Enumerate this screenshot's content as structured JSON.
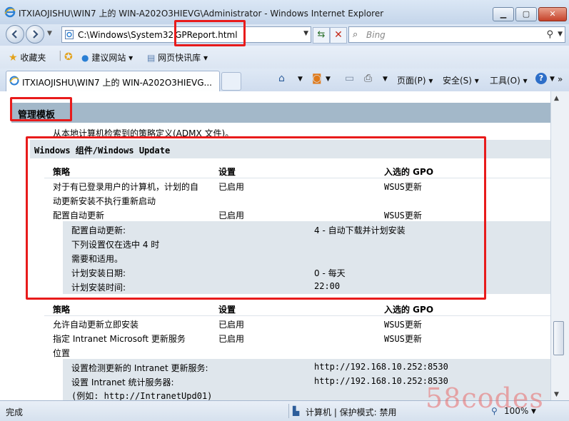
{
  "window": {
    "title": "ITXIAOJISHU\\WIN7 上的 WIN-A202O3HIEVG\\Administrator - Windows Internet Explorer"
  },
  "address_bar": {
    "url_prefix": "C:\\Windows\\System32",
    "url_file": "GPReport.html",
    "search_placeholder": "Bing"
  },
  "favorites_bar": {
    "favorites_label": "收藏夹",
    "suggested_sites": "建议网站",
    "web_slice_gallery": "网页快讯库"
  },
  "tab": {
    "title": "ITXIAOJISHU\\WIN7 上的 WIN-A202O3HIEVG..."
  },
  "command_bar": {
    "page_menu": "页面(P)",
    "safety_menu": "安全(S)",
    "tools_menu": "工具(O)"
  },
  "report": {
    "section_title": "管理模板",
    "description": "从本地计算机检索到的策略定义(ADMX 文件)。",
    "subsection_title": "Windows 组件/Windows Update",
    "col_policy": "策略",
    "col_setting": "设置",
    "col_gpo": "入选的 GPO",
    "rows_group1": [
      {
        "policy_l1": "对于有已登录用户的计算机，计划的自",
        "policy_l2": "动更新安装不执行重新启动",
        "setting": "已启用",
        "gpo": "WSUS更新"
      },
      {
        "policy_l1": "配置自动更新",
        "policy_l2": "",
        "setting": "已启用",
        "gpo": "WSUS更新"
      }
    ],
    "details_group1": {
      "configure_label": "配置自动更新:",
      "configure_value": "4 - 自动下载并计划安装",
      "note_l1": "下列设置仅在选中 4 时",
      "note_l2": "需要和适用。",
      "day_label": "计划安装日期:",
      "day_value": "0 - 每天",
      "time_label": "计划安装时间:",
      "time_value": "22:00"
    },
    "rows_group2": [
      {
        "policy_l1": "允许自动更新立即安装",
        "policy_l2": "",
        "setting": "已启用",
        "gpo": "WSUS更新"
      },
      {
        "policy_l1": "指定 Intranet Microsoft 更新服务",
        "policy_l2": "位置",
        "setting": "已启用",
        "gpo": "WSUS更新"
      }
    ],
    "details_group2": {
      "detect_label": "设置检测更新的 Intranet 更新服务:",
      "detect_value": "http://192.168.10.252:8530",
      "stats_label": "设置 Intranet 统计服务器:",
      "stats_value": "http://192.168.10.252:8530",
      "example": "(例如: http://IntranetUpd01)"
    }
  },
  "status_bar": {
    "status": "完成",
    "zone": "计算机 | 保护模式: 禁用",
    "zoom": "100%"
  },
  "watermark": "58codes"
}
